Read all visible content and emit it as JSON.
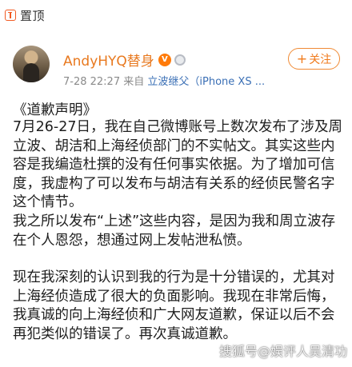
{
  "pin": {
    "label": "置顶"
  },
  "author": {
    "name": "AndyHYQ替身",
    "vip_badge": "V",
    "time": "7-28 22:27",
    "source_prefix": "来自",
    "source": "立波继父（iPhone XS ..."
  },
  "follow_label": "关注",
  "post": {
    "title": "《道歉声明》",
    "paragraphs": [
      "7月26-27日，我在自己微博账号上数次发布了涉及周立波、胡洁和上海经侦部门的不实帖文。其实这些内容是我编造杜撰的没有任何事实依据。为了增加可信度，我虚构了可以发布与胡洁有关系的经侦民警名字这个情节。",
      "我之所以发布“上述”这些内容，是因为我和周立波存在个人恩怨，想通过网上发帖泄私愤。",
      "现在我深刻的认识到我的行为是十分错误的，尤其对上海经侦造成了很大的负面影响。我现在非常后悔，我真诚的向上海经侦和广大网友道歉，保证以后不会再犯类似的错误了。再次真诚道歉。"
    ]
  },
  "watermark": "搜狐号@娱评人吴清功",
  "colors": {
    "accent_orange": "#f07a1b",
    "source_blue": "#3a6fb5"
  }
}
